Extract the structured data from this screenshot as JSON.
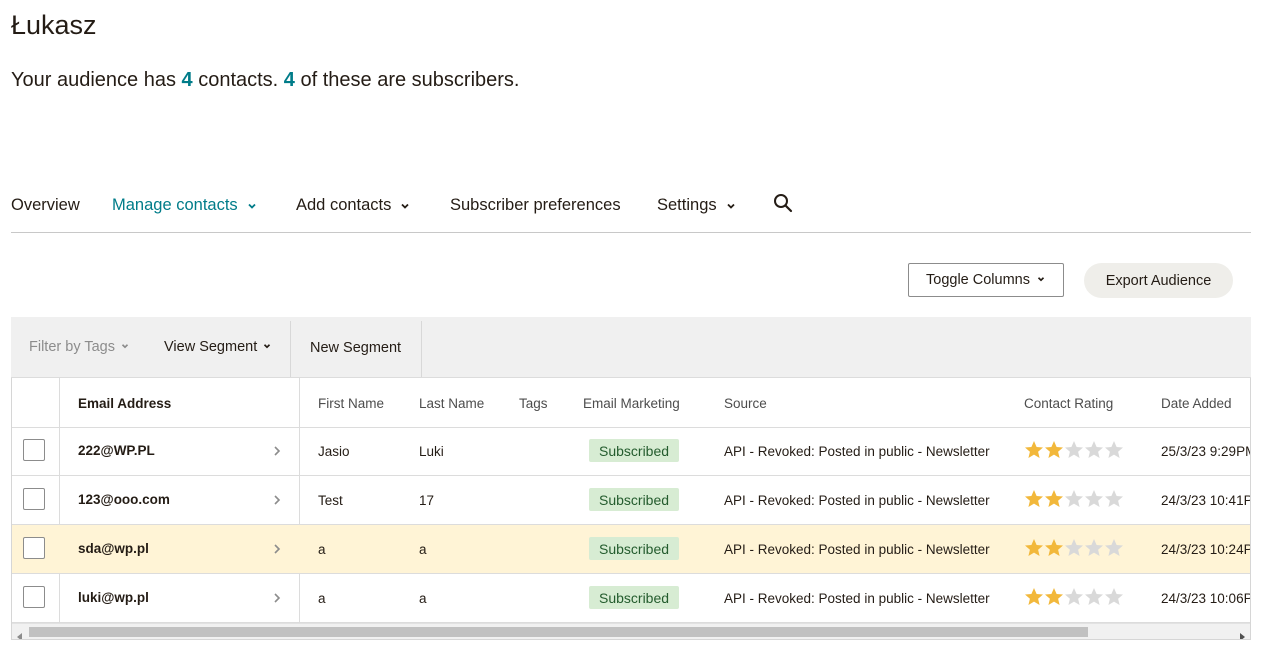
{
  "page": {
    "title": "Łukasz",
    "summary_prefix": "Your audience has ",
    "contacts_count": "4",
    "summary_mid": " contacts. ",
    "subscribers_count": "4",
    "summary_suffix": " of these are subscribers."
  },
  "nav": {
    "tabs": [
      {
        "label": "Overview",
        "active": false
      },
      {
        "label": "Manage contacts",
        "active": true
      },
      {
        "label": "Add contacts",
        "active": false
      },
      {
        "label": "Subscriber preferences",
        "active": false
      },
      {
        "label": "Settings",
        "active": false
      }
    ],
    "search_icon": "search-icon"
  },
  "actions": {
    "toggle_columns": "Toggle Columns",
    "export_audience": "Export Audience"
  },
  "filters": {
    "filter_by_tags": "Filter by Tags",
    "view_segment": "View Segment",
    "new_segment": "New Segment"
  },
  "table": {
    "columns": [
      "Email Address",
      "First Name",
      "Last Name",
      "Tags",
      "Email Marketing",
      "Source",
      "Contact Rating",
      "Date Added"
    ],
    "rows": [
      {
        "email": "222@WP.PL",
        "first": "Jasio",
        "last": "Luki",
        "tags": "",
        "marketing": "Subscribed",
        "source": "API - Revoked: Posted in public - Newsletter",
        "rating": 2,
        "date": "25/3/23 9:29PM",
        "highlighted": false
      },
      {
        "email": "123@ooo.com",
        "first": "Test",
        "last": "17",
        "tags": "",
        "marketing": "Subscribed",
        "source": "API - Revoked: Posted in public - Newsletter",
        "rating": 2,
        "date": "24/3/23 10:41P",
        "highlighted": false
      },
      {
        "email": "sda@wp.pl",
        "first": "a",
        "last": "a",
        "tags": "",
        "marketing": "Subscribed",
        "source": "API - Revoked: Posted in public - Newsletter",
        "rating": 2,
        "date": "24/3/23 10:24P",
        "highlighted": true
      },
      {
        "email": "luki@wp.pl",
        "first": "a",
        "last": "a",
        "tags": "",
        "marketing": "Subscribed",
        "source": "API - Revoked: Posted in public - Newsletter",
        "rating": 2,
        "date": "24/3/23 10:06P",
        "highlighted": false
      }
    ],
    "rating_max": 5
  },
  "colors": {
    "accent": "#007c89",
    "star_filled": "#f2b83b",
    "star_empty": "#d9d9d9",
    "badge_bg": "#d7ecd3",
    "highlight_row": "#fff4d6"
  }
}
